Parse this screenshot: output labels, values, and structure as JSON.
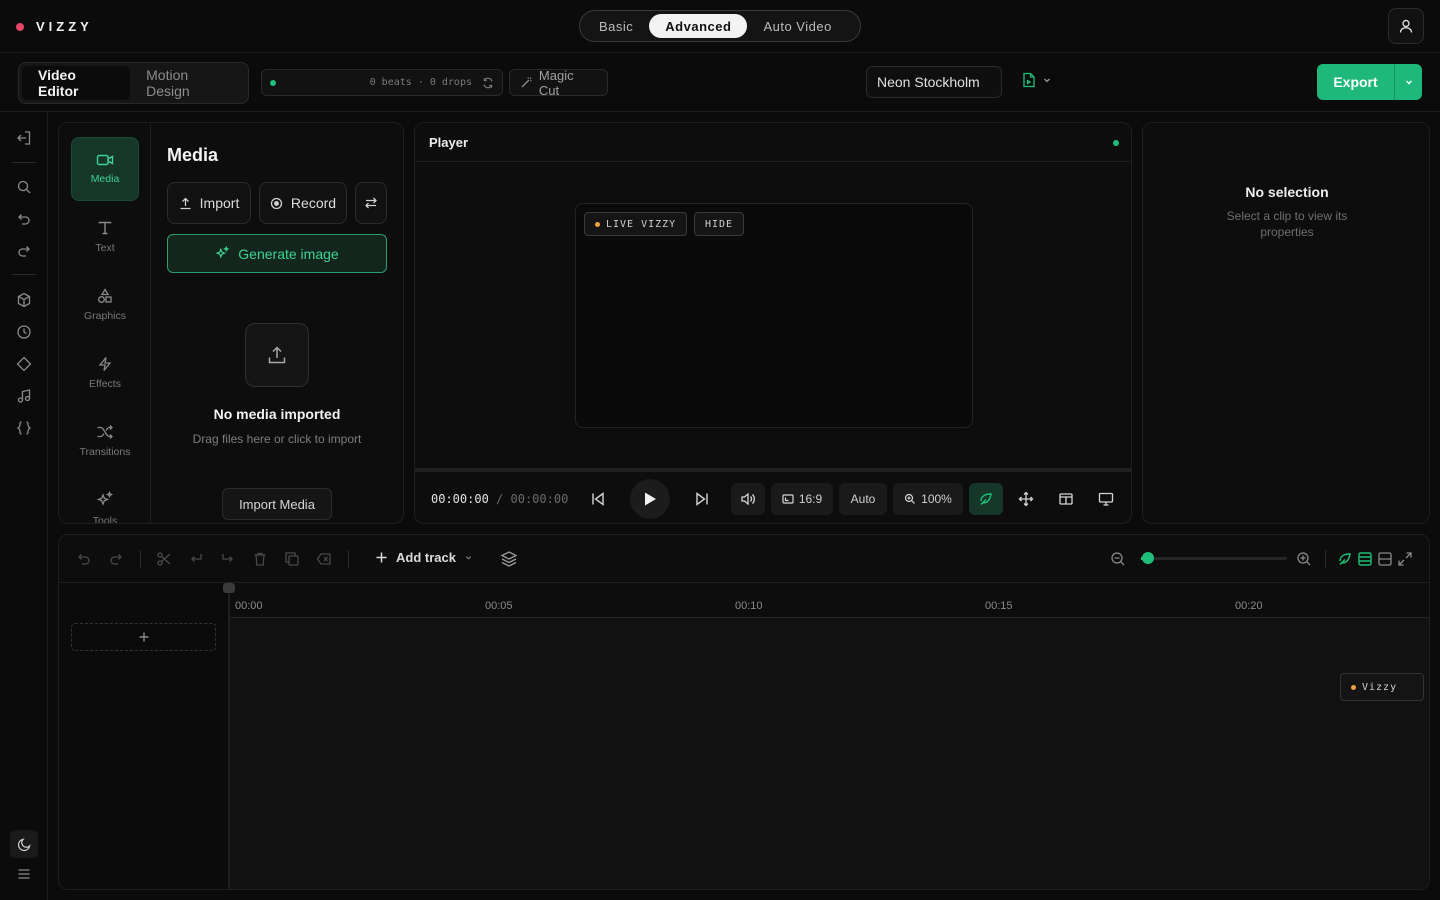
{
  "brand": {
    "name": "VIZZY"
  },
  "mode_tabs": [
    "Basic",
    "Advanced",
    "Auto Video"
  ],
  "mode_active": "Advanced",
  "editor_tabs": [
    "Video Editor",
    "Motion Design"
  ],
  "beats_status": "0 beats · 0 drops",
  "magic_cut_label": "Magic Cut",
  "project_name": "Neon Stockholm",
  "export_label": "Export",
  "categories": [
    "Media",
    "Text",
    "Graphics",
    "Effects",
    "Transitions",
    "Tools"
  ],
  "media": {
    "title": "Media",
    "import_label": "Import",
    "record_label": "Record",
    "generate_label": "Generate image",
    "empty_title": "No media imported",
    "empty_hint": "Drag files here or click to import",
    "import_media_label": "Import Media"
  },
  "player": {
    "title": "Player",
    "chip_live": "LIVE VIZZY",
    "chip_hide": "HIDE",
    "current_time": "00:00:00",
    "separator": "/",
    "total_time": "00:00:00",
    "aspect": "16:9",
    "quality": "Auto",
    "zoom": "100%"
  },
  "properties": {
    "title": "No selection",
    "hint": "Select a clip to view its properties"
  },
  "timeline": {
    "add_track_label": "Add track",
    "ticks": [
      "00:00",
      "00:05",
      "00:10",
      "00:15",
      "00:20"
    ],
    "zoom_level": 0.05,
    "badge": "Vizzy"
  },
  "colors": {
    "accent": "#1db87a",
    "accent_text": "#3fd393",
    "brand_dot": "#e8456b",
    "live_dot": "#f0a040",
    "background": "#0b0b0b"
  }
}
